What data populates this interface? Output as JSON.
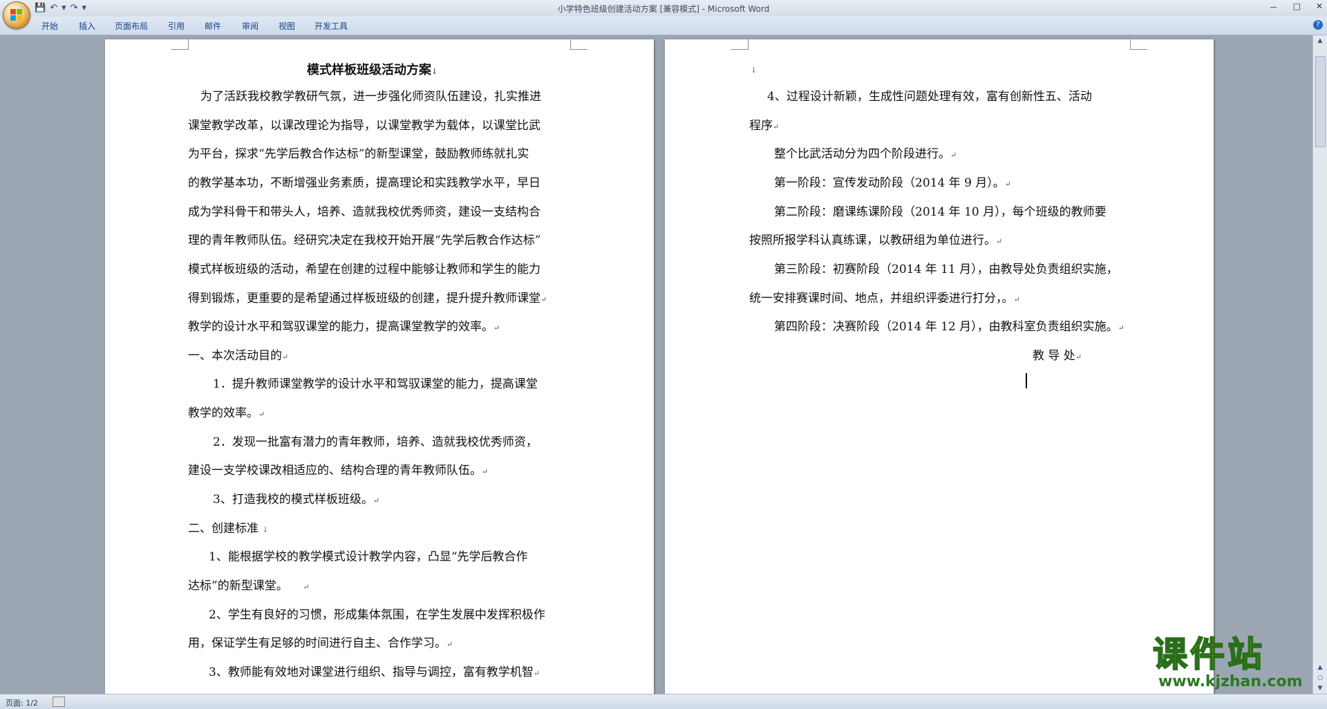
{
  "window": {
    "title": "小学特色班级创建活动方案 [兼容模式] - Microsoft Word",
    "controls": [
      "－",
      "□",
      "✕"
    ]
  },
  "qat": [
    "💾",
    "↶",
    "▾",
    "↷",
    "▾"
  ],
  "tabs": [
    "开始",
    "插入",
    "页面布局",
    "引用",
    "邮件",
    "审阅",
    "视图",
    "开发工具"
  ],
  "page1": {
    "title": "模式样板班级活动方案",
    "lines": [
      "为了活跃我校教学教研气氛，进一步强化师资队伍建设，扎实推进",
      "课堂教学改革，以课改理论为指导，以课堂教学为载体，以课堂比武",
      "为平台，探求“先学后教合作达标”的新型课堂，鼓励教师练就扎实",
      "的教学基本功，不断增强业务素质，提高理论和实践教学水平，早日",
      "成为学科骨干和带头人，培养、造就我校优秀师资，建设一支结构合",
      "理的青年教师队伍。经研究决定在我校开始开展“先学后教合作达标”",
      "模式样板班级的活动，希望在创建的过程中能够让教师和学生的能力",
      "得到锻炼，更重要的是希望通过样板班级的创建，提升提升教师课堂",
      "教学的设计水平和驾驭课堂的能力，提高课堂教学的效率。",
      "一、本次活动目的",
      "1．提升教师课堂教学的设计水平和驾驭课堂的能力，提高课堂",
      "教学的效率。",
      "2．发现一批富有潜力的青年教师，培养、造就我校优秀师资，",
      "建设一支学校课改相适应的、结构合理的青年教师队伍。",
      "3、打造我校的模式样板班级。",
      "二、创建标准",
      "1、能根据学校的教学模式设计教学内容，凸显“先学后教合作",
      "达标”的新型课堂。",
      "2、学生有良好的习惯，形成集体氛围，在学生发展中发挥积极作",
      "用，保证学生有足够的时间进行自主、合作学习。",
      "3、教师能有效地对课堂进行组织、指导与调控，富有教学机智"
    ]
  },
  "page2": {
    "lines": [
      "4、过程设计新颖，生成性问题处理有效，富有创新性五、活动",
      "程序",
      "整个比武活动分为四个阶段进行。",
      "第一阶段：宣传发动阶段（2014 年 9 月）。",
      "第二阶段：磨课练课阶段（2014  年  10  月），每个班级的教师要",
      "按照所报学科认真练课，以教研组为单位进行。",
      "第三阶段：初赛阶段（2014 年 11 月），由教导处负责组织实施，",
      "统一安排赛课时间、地点，并组织评委进行打分，。",
      "第四阶段：决赛阶段（2014 年 12 月），由教科室负责组织实施。",
      "教   导   处"
    ]
  },
  "marks": {
    "para": "↵",
    "down": "↓"
  },
  "status": {
    "pages": "页面: 1/2"
  },
  "watermark": {
    "main": "课件站",
    "url": "www.kjzhan.com"
  },
  "colors": {
    "tab_text": "#15428b",
    "doc_bg": "#9ba6b2"
  }
}
